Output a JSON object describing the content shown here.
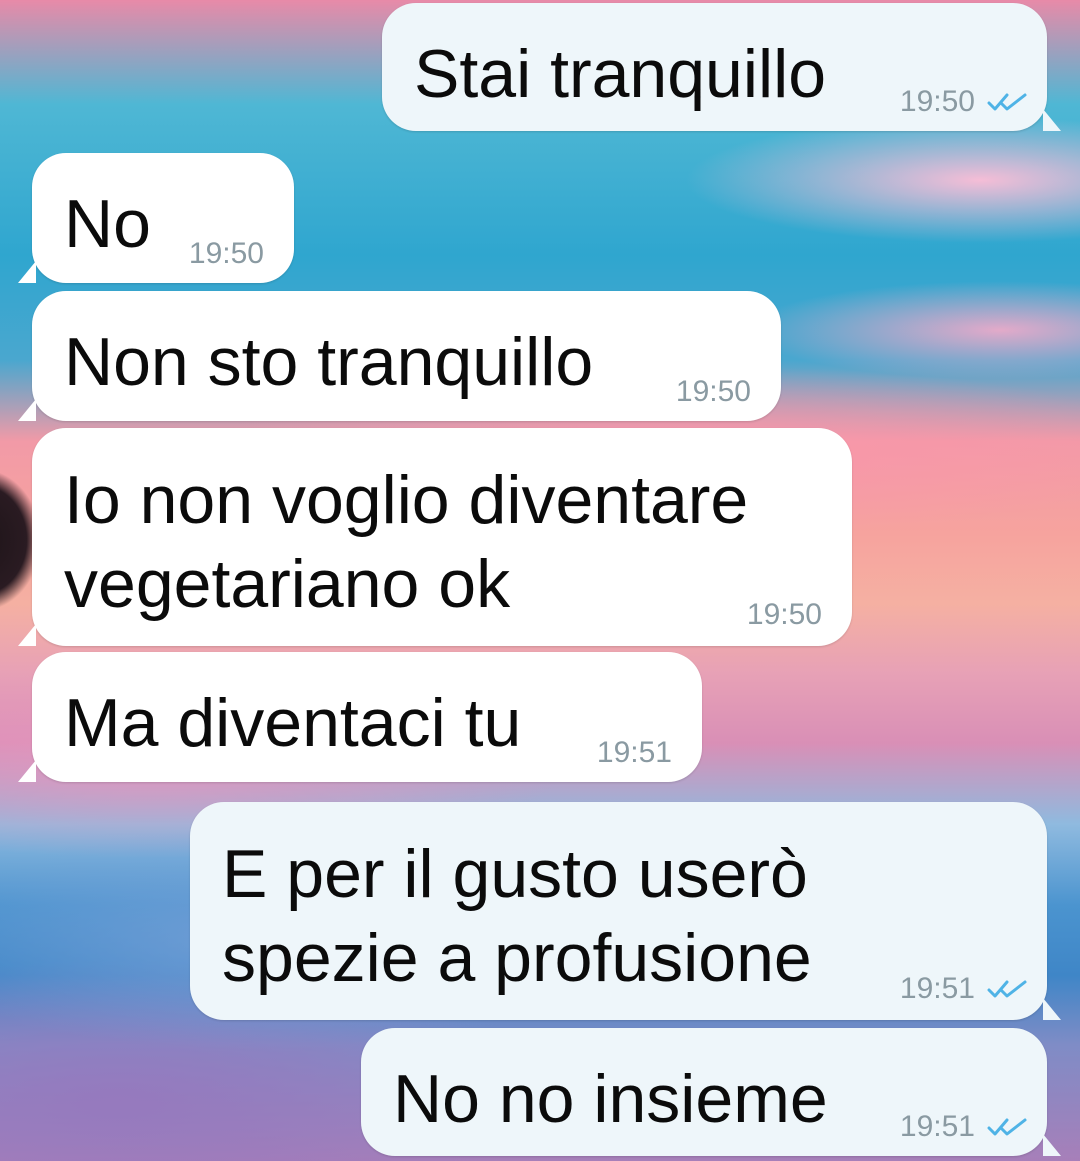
{
  "chat": {
    "messages": [
      {
        "id": "m1",
        "direction": "outgoing",
        "text": "Stai tranquillo",
        "time": "19:50",
        "status_icon": "double-check-icon"
      },
      {
        "id": "m2",
        "direction": "incoming",
        "text": "No",
        "time": "19:50"
      },
      {
        "id": "m3",
        "direction": "incoming",
        "text": "Non sto tranquillo",
        "time": "19:50"
      },
      {
        "id": "m4",
        "direction": "incoming",
        "text": "Io non voglio diventare\nvegetariano ok",
        "time": "19:50"
      },
      {
        "id": "m5",
        "direction": "incoming",
        "text": "Ma diventaci tu",
        "time": "19:51"
      },
      {
        "id": "m6",
        "direction": "outgoing",
        "text": "E per il gusto userò\nspezie a profusione",
        "time": "19:51",
        "status_icon": "double-check-icon"
      },
      {
        "id": "m7",
        "direction": "outgoing",
        "text": "No no insieme",
        "time": "19:51",
        "status_icon": "double-check-icon"
      }
    ]
  },
  "colors": {
    "incoming_bubble": "#ffffff",
    "outgoing_bubble": "#eef6fa",
    "timestamp": "#8a9aa2",
    "read_ticks": "#4fb3e6"
  }
}
